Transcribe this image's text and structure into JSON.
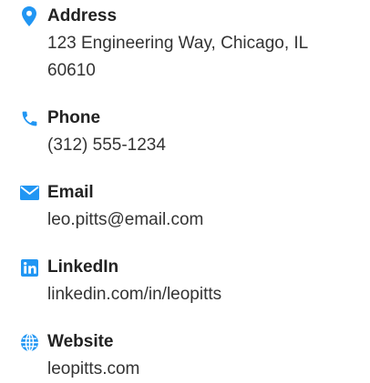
{
  "colors": {
    "icon": "#2196f3",
    "label": "#222222",
    "value": "#333333"
  },
  "contacts": [
    {
      "icon": "map-pin-icon",
      "label": "Address",
      "value": "123 Engineering Way, Chicago, IL 60610"
    },
    {
      "icon": "phone-icon",
      "label": "Phone",
      "value": "(312) 555-1234"
    },
    {
      "icon": "envelope-icon",
      "label": "Email",
      "value": "leo.pitts@email.com"
    },
    {
      "icon": "linkedin-icon",
      "label": "LinkedIn",
      "value": "linkedin.com/in/leopitts"
    },
    {
      "icon": "globe-icon",
      "label": "Website",
      "value": "leopitts.com"
    }
  ]
}
